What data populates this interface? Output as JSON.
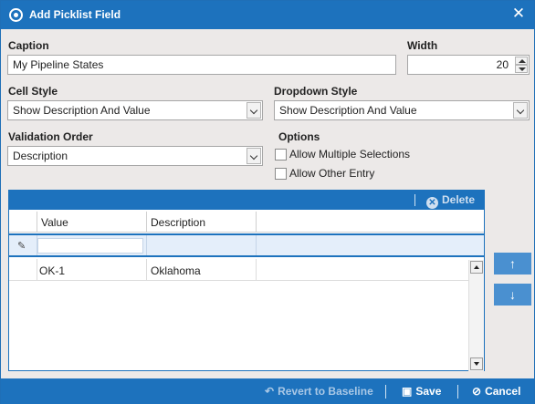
{
  "window": {
    "title": "Add Picklist Field",
    "close_glyph": "✕"
  },
  "caption": {
    "label": "Caption",
    "value": "My Pipeline States"
  },
  "width": {
    "label": "Width",
    "value": "20"
  },
  "cell_style": {
    "label": "Cell Style",
    "value": "Show Description And Value"
  },
  "dropdown_style": {
    "label": "Dropdown Style",
    "value": "Show Description And Value"
  },
  "validation_order": {
    "label": "Validation Order",
    "value": "Description"
  },
  "options": {
    "label": "Options",
    "allow_multiple": {
      "label": "Allow Multiple Selections",
      "checked": false
    },
    "allow_other": {
      "label": "Allow Other Entry",
      "checked": false
    }
  },
  "grid": {
    "toolbar": {
      "delete_label": "Delete",
      "delete_icon": "x-circle-icon"
    },
    "columns": [
      "Value",
      "Description"
    ],
    "new_row_icon": "pencil-icon",
    "rows": [
      {
        "value": "OK-1",
        "description": "Oklahoma"
      }
    ]
  },
  "move_buttons": {
    "up_glyph": "↑",
    "down_glyph": "↓"
  },
  "footer": {
    "revert_label": "Revert to Baseline",
    "save_label": "Save",
    "cancel_label": "Cancel"
  },
  "colors": {
    "accent": "#1d72bd",
    "background": "#ece9e8",
    "move_button": "#4a90d0"
  }
}
